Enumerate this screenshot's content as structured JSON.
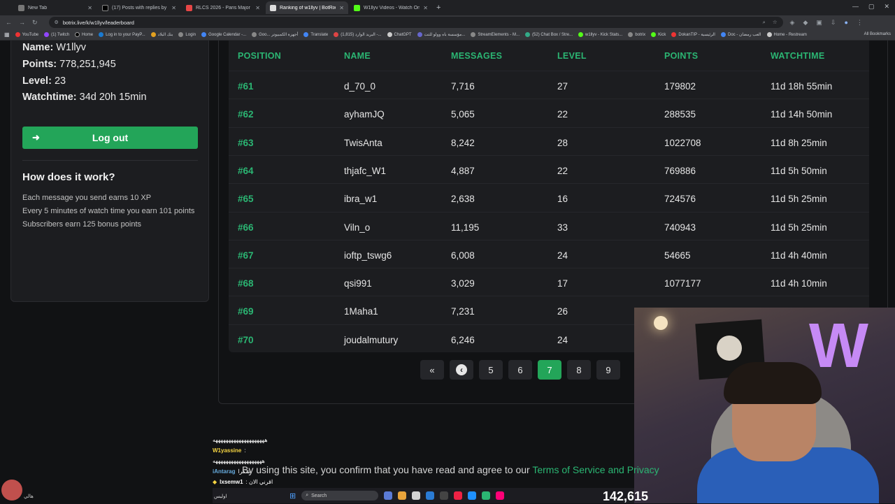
{
  "browser": {
    "tabs": [
      {
        "title": "New Tab",
        "active": false
      },
      {
        "title": "(17) Posts with replies by نبيل",
        "active": false
      },
      {
        "title": "RLCS 2026 - Paris Major Middle",
        "active": false
      },
      {
        "title": "Ranking of w1llyv | BotRix — Ch",
        "active": true
      },
      {
        "title": "W1llyv Videos - Watch On-Dem",
        "active": false
      }
    ],
    "url": "botrix.live/k/w1llyv/leaderboard",
    "bookmarks": [
      "YouTube",
      "(1) Twitch",
      "Home",
      "Log in to your PayP...",
      "بنك البلاد",
      "Login",
      "Google Calendar -...",
      "Goo... أجهزة الكمبيوتر",
      "Translate",
      "(1,815) البريد الوارد -...",
      "ChatGPT",
      "مؤسسة باه وولو للتت...",
      "StreamElements - M...",
      "(52) Chat Box / Stre...",
      "w1llyv - Kick Stats...",
      "botrix",
      "Kick",
      "DokanTIP - الرئيسية",
      "Doc - العب رمضان",
      "Home - Restream"
    ],
    "all_bookmarks": "All Bookmarks"
  },
  "profile": {
    "name_label": "Name:",
    "name_value": "W1llyv",
    "points_label": "Points:",
    "points_value": "778,251,945",
    "level_label": "Level:",
    "level_value": "23",
    "watchtime_label": "Watchtime:",
    "watchtime_value": "34d 20h 15min",
    "logout_label": "Log out",
    "how_title": "How does it work?",
    "how_lines": [
      "Each message you send earns 10 XP",
      "Every 5 minutes of watch time you earn 101 points",
      "Subscribers earn 125 bonus points"
    ]
  },
  "leaderboard": {
    "headers": [
      "POSITION",
      "NAME",
      "MESSAGES",
      "LEVEL",
      "POINTS",
      "WATCHTIME"
    ],
    "rows": [
      [
        "#61",
        "d_70_0",
        "7,716",
        "27",
        "179802",
        "11d 18h 55min"
      ],
      [
        "#62",
        "ayhamJQ",
        "5,065",
        "22",
        "288535",
        "11d 14h 50min"
      ],
      [
        "#63",
        "TwisAnta",
        "8,242",
        "28",
        "1022708",
        "11d 8h 25min"
      ],
      [
        "#64",
        "thjafc_W1",
        "4,887",
        "22",
        "769886",
        "11d 5h 50min"
      ],
      [
        "#65",
        "ibra_w1",
        "2,638",
        "16",
        "724576",
        "11d 5h 25min"
      ],
      [
        "#66",
        "Viln_o",
        "11,195",
        "33",
        "740943",
        "11d 5h 25min"
      ],
      [
        "#67",
        "ioftp_tswg6",
        "6,008",
        "24",
        "54665",
        "11d 4h 40min"
      ],
      [
        "#68",
        "qsi991",
        "3,029",
        "17",
        "1077177",
        "11d 4h 10min"
      ],
      [
        "#69",
        "1Maha1",
        "7,231",
        "26",
        "",
        ""
      ],
      [
        "#70",
        "joudalmutury",
        "6,246",
        "24",
        "",
        ""
      ]
    ],
    "pagination": {
      "first": "«",
      "prev": "‹",
      "pages": [
        "5",
        "6",
        "7",
        "8",
        "9"
      ],
      "current": "7"
    }
  },
  "overlay": {
    "chat": [
      {
        "user": "",
        "text": "ههههههههههههههههههههه"
      },
      {
        "user": "W1yassine",
        "text": ":"
      },
      {
        "user": "",
        "text": "هههههههههههههههههههه"
      },
      {
        "user": "iAntarag",
        "text": "شكرا"
      },
      {
        "user": "lxsemw1",
        "text": ": اقرني الان"
      }
    ],
    "terms_text": "By using this site, you confirm that you have read and agree to our",
    "terms_link": "Terms of Service and Privacy",
    "viewer_count": "142,615",
    "taskbar_search": "Search",
    "bottom_left_text": "هالي",
    "chat_footer_name": "اوليس"
  }
}
